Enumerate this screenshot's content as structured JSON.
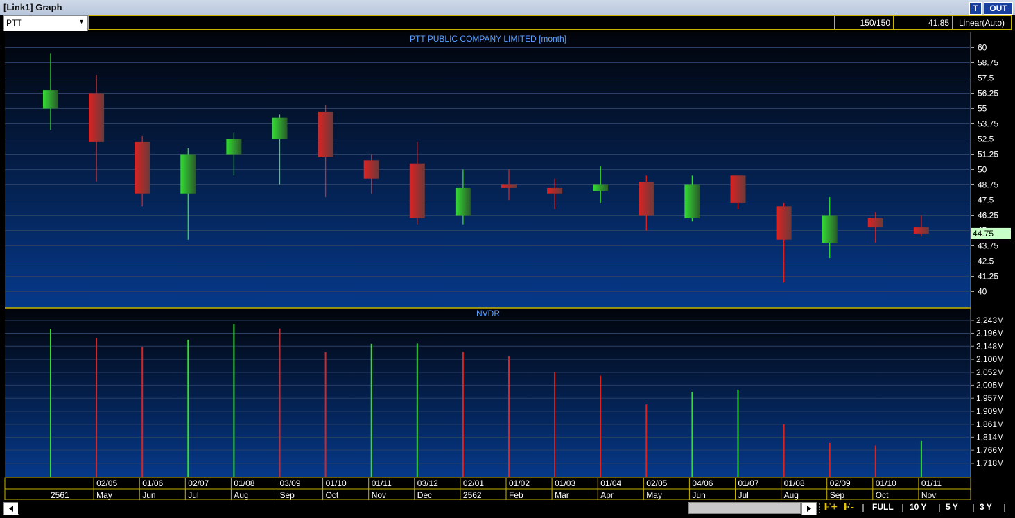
{
  "window": {
    "title": "[Link1] Graph",
    "btn_t": "T",
    "btn_out": "OUT"
  },
  "toolbar": {
    "symbol": "PTT",
    "count": "150/150",
    "price": "41.85",
    "scale": "Linear(Auto)"
  },
  "bottom": {
    "zoom": [
      "FULL",
      "10 Y",
      "5 Y",
      "3 Y"
    ],
    "f_plus": "F+",
    "f_minus": "F-"
  },
  "colors": {
    "up": "#33dd33",
    "down": "#dd2222",
    "accent": "#c8b400",
    "title": "#5aa0ff",
    "highlight": "#c8ffc8"
  },
  "chart_data": [
    {
      "type": "candlestick",
      "title": "PTT PUBLIC COMPANY LIMITED [month]",
      "ylim": [
        40,
        60
      ],
      "yticks": [
        "60",
        "58.75",
        "57.5",
        "56.25",
        "55",
        "53.75",
        "52.5",
        "51.25",
        "50",
        "48.75",
        "47.5",
        "46.25",
        "45",
        "43.75",
        "42.5",
        "41.25",
        "40"
      ],
      "last_value_label": "44.75",
      "last_value": 44.75,
      "candles": [
        {
          "open": 55.0,
          "high": 59.5,
          "low": 53.25,
          "close": 56.5
        },
        {
          "open": 56.25,
          "high": 57.75,
          "low": 49.0,
          "close": 52.25
        },
        {
          "open": 52.25,
          "high": 52.75,
          "low": 47.0,
          "close": 48.0
        },
        {
          "open": 48.0,
          "high": 51.75,
          "low": 44.25,
          "close": 51.25
        },
        {
          "open": 51.25,
          "high": 53.0,
          "low": 49.5,
          "close": 52.5
        },
        {
          "open": 52.5,
          "high": 54.5,
          "low": 48.75,
          "close": 54.25
        },
        {
          "open": 54.75,
          "high": 55.25,
          "low": 47.75,
          "close": 51.0
        },
        {
          "open": 50.75,
          "high": 51.25,
          "low": 48.0,
          "close": 49.25
        },
        {
          "open": 50.5,
          "high": 52.25,
          "low": 45.5,
          "close": 46.0
        },
        {
          "open": 46.25,
          "high": 50.0,
          "low": 45.5,
          "close": 48.5
        },
        {
          "open": 48.75,
          "high": 50.0,
          "low": 47.5,
          "close": 48.5
        },
        {
          "open": 48.5,
          "high": 49.25,
          "low": 46.75,
          "close": 48.0
        },
        {
          "open": 48.25,
          "high": 50.25,
          "low": 47.25,
          "close": 48.75
        },
        {
          "open": 49.0,
          "high": 49.5,
          "low": 45.0,
          "close": 46.25
        },
        {
          "open": 46.0,
          "high": 49.5,
          "low": 45.75,
          "close": 48.75
        },
        {
          "open": 49.5,
          "high": 49.5,
          "low": 46.75,
          "close": 47.25
        },
        {
          "open": 47.0,
          "high": 47.25,
          "low": 40.75,
          "close": 44.25
        },
        {
          "open": 44.0,
          "high": 47.75,
          "low": 42.75,
          "close": 46.25
        },
        {
          "open": 46.0,
          "high": 46.5,
          "low": 44.0,
          "close": 45.25
        },
        {
          "open": 45.25,
          "high": 46.25,
          "low": 44.5,
          "close": 44.75
        }
      ]
    },
    {
      "type": "bar",
      "title": "NVDR",
      "ylim": [
        1680,
        2260
      ],
      "yticks": [
        "2,243M",
        "2,196M",
        "2,148M",
        "2,100M",
        "2,052M",
        "2,005M",
        "1,957M",
        "1,909M",
        "1,861M",
        "1,814M",
        "1,766M",
        "1,718M"
      ],
      "values": [
        2212,
        2177,
        2145,
        2172,
        2230,
        2213,
        2126,
        2157,
        2158,
        2127,
        2110,
        2054,
        2040,
        1934,
        1980,
        1988,
        1861,
        1792,
        1783,
        1800
      ],
      "up": [
        true,
        false,
        false,
        true,
        true,
        false,
        false,
        true,
        true,
        false,
        false,
        false,
        false,
        false,
        true,
        true,
        false,
        false,
        false,
        true
      ]
    }
  ],
  "xaxis": {
    "row1": [
      "",
      "02/05",
      "01/06",
      "02/07",
      "01/08",
      "03/09",
      "01/10",
      "01/11",
      "03/12",
      "02/01",
      "01/02",
      "01/03",
      "01/04",
      "02/05",
      "04/06",
      "01/07",
      "01/08",
      "02/09",
      "01/10",
      "01/11"
    ],
    "row2": [
      "2561",
      "May",
      "Jun",
      "Jul",
      "Aug",
      "Sep",
      "Oct",
      "Nov",
      "Dec",
      "2562",
      "Feb",
      "Mar",
      "Apr",
      "May",
      "Jun",
      "Jul",
      "Aug",
      "Sep",
      "Oct",
      "Nov"
    ]
  }
}
